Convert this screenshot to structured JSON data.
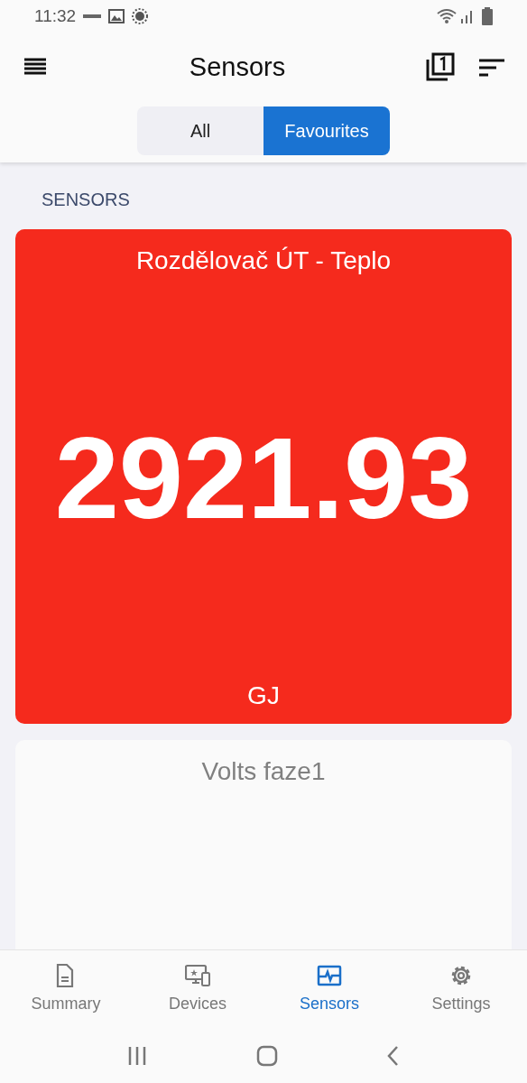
{
  "status_bar": {
    "time": "11:32"
  },
  "app_bar": {
    "title": "Sensors"
  },
  "segments": [
    {
      "label": "All",
      "selected": false
    },
    {
      "label": "Favourites",
      "selected": true
    }
  ],
  "section_header": "SENSORS",
  "cards": [
    {
      "title": "Rozdělovač ÚT - Teplo",
      "value": "2921.93",
      "unit": "GJ",
      "color": "#f52a1d"
    },
    {
      "title": "Volts faze1",
      "color": "#fafafa"
    }
  ],
  "bottom_nav": [
    {
      "label": "Summary",
      "kind": "document",
      "selected": false
    },
    {
      "label": "Devices",
      "kind": "devices",
      "selected": false
    },
    {
      "label": "Sensors",
      "kind": "sensor",
      "selected": true
    },
    {
      "label": "Settings",
      "kind": "gear",
      "selected": false
    }
  ]
}
